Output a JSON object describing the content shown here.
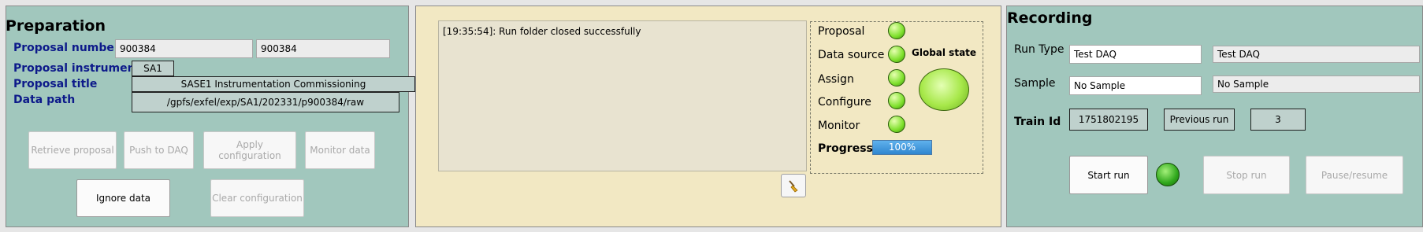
{
  "preparation": {
    "title": "Preparation",
    "proposal_number_label": "Proposal number",
    "proposal_number_value1": "900384",
    "proposal_number_value2": "900384",
    "proposal_instrument_label": "Proposal instrument",
    "proposal_instrument_value": "SA1",
    "proposal_title_label": "Proposal title",
    "proposal_title_value": "SASE1 Instrumentation Commissioning",
    "data_path_label": "Data path",
    "data_path_value": "/gpfs/exfel/exp/SA1/202331/p900384/raw",
    "buttons": {
      "retrieve": "Retrieve proposal",
      "push": "Push to DAQ",
      "apply": "Apply configuration",
      "monitor": "Monitor data",
      "ignore": "Ignore data",
      "clear": "Clear configuration"
    }
  },
  "log": {
    "entries": [
      "[19:35:54]: Run folder closed successfully"
    ],
    "clear_icon": "broom-icon"
  },
  "status": {
    "items": [
      "Proposal",
      "Data source",
      "Assign",
      "Configure",
      "Monitor"
    ],
    "global_state_label": "Global state",
    "progress_label": "Progress",
    "progress_text": "100%",
    "progress_value": 1.0,
    "colors": {
      "ok": "#7ee02c",
      "progress": "#3a8fd6",
      "state": "#a7e84a"
    }
  },
  "recording": {
    "title": "Recording",
    "run_type_label": "Run Type",
    "run_type_value1": "Test DAQ",
    "run_type_value2": "Test DAQ",
    "sample_label": "Sample",
    "sample_value1": "No Sample",
    "sample_value2": "No Sample",
    "train_id_label": "Train Id",
    "train_id_value": "1751802195",
    "previous_run_label": "Previous run",
    "previous_run_value": "3",
    "buttons": {
      "start": "Start run",
      "stop": "Stop run",
      "pause": "Pause/resume"
    }
  }
}
